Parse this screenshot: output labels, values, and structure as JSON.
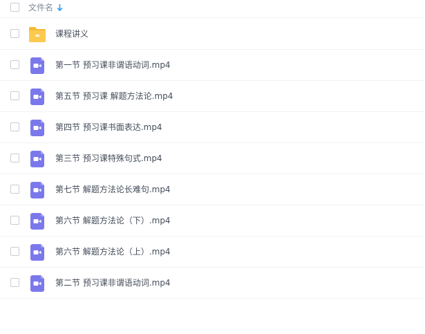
{
  "header": {
    "column_label": "文件名",
    "sort_icon": "arrow-down-icon",
    "sort_color": "#2a9df4"
  },
  "files": [
    {
      "name": "课程讲义",
      "type": "folder",
      "icon": "folder-icon"
    },
    {
      "name": "第一节 预习课非谓语动词.mp4",
      "type": "video",
      "icon": "video-file-icon"
    },
    {
      "name": "第五节 预习课 解题方法论.mp4",
      "type": "video",
      "icon": "video-file-icon"
    },
    {
      "name": "第四节 预习课书面表达.mp4",
      "type": "video",
      "icon": "video-file-icon"
    },
    {
      "name": "第三节 预习课特殊句式.mp4",
      "type": "video",
      "icon": "video-file-icon"
    },
    {
      "name": "第七节 解题方法论长难句.mp4",
      "type": "video",
      "icon": "video-file-icon"
    },
    {
      "name": "第六节 解题方法论（下）.mp4",
      "type": "video",
      "icon": "video-file-icon"
    },
    {
      "name": "第六节 解题方法论（上）.mp4",
      "type": "video",
      "icon": "video-file-icon"
    },
    {
      "name": "第二节 预习课非谓语动词.mp4",
      "type": "video",
      "icon": "video-file-icon"
    }
  ],
  "colors": {
    "folder": "#fcca4e",
    "folder_tab": "#f5b935",
    "video": "#7b78ec"
  }
}
